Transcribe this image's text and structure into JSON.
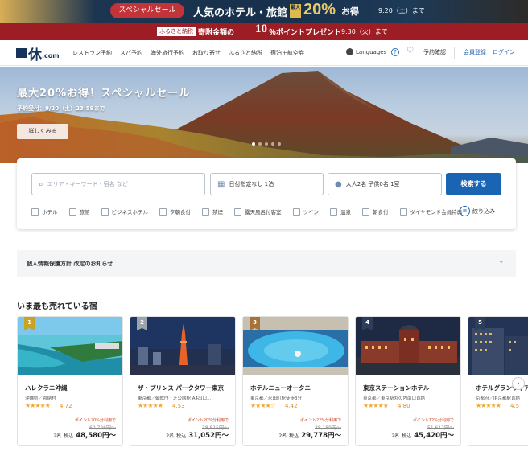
{
  "sale_banner": {
    "pill": "スペシャルセール",
    "title": "人気のホテル・旅館",
    "badge": "最大",
    "percent": "20%",
    "suffix": "お得",
    "date": "9.20（土）まで"
  },
  "furusato_banner": {
    "tag": "ふるさと納税",
    "text_before": "寄附金額の",
    "number": "10",
    "text_after": "％ポイントプレゼント",
    "date": "9.30（火）まで"
  },
  "nav": {
    "logo_kanji": "休",
    "logo_suffix": ".com",
    "links": [
      "レストラン予約",
      "スパ予約",
      "海外旅行予約",
      "お取り寄せ",
      "ふるさと納税",
      "宿泊＋航空券"
    ],
    "languages": "Languages",
    "help_icon": "?",
    "reservation": "予約確認",
    "member_register": "会員登録",
    "login": "ログイン"
  },
  "hero": {
    "title": "最大20%お得！スペシャルセール",
    "subtitle": "予約受付：9/20（土）23:59まで",
    "button": "詳しくみる",
    "slide_count": 5,
    "active_slide": 1
  },
  "search": {
    "area_placeholder": "エリア・キーワード・宿名 など",
    "date_value": "日付指定なし 1泊",
    "guest_value": "大人2名 子供0名 1室",
    "search_button": "検索する",
    "filters": [
      "ホテル",
      "旅館",
      "ビジネスホテル",
      "夕朝食付",
      "禁煙",
      "露天風呂付客室",
      "ツイン",
      "温泉",
      "朝食付",
      "ダイヤモンド会員特典"
    ],
    "more_filters": "絞り込み"
  },
  "notice": {
    "text": "個人情報保護方針 改定のお知らせ"
  },
  "best_sellers": {
    "title": "いま最も売れている宿",
    "hotels": [
      {
        "rank": "1",
        "name": "ハレクラニ沖縄",
        "location": "沖縄県／恩納村",
        "stars": "★★★★★",
        "score": "4.72",
        "points": "ポイント20%分利用で",
        "original_price": "60,726円〜",
        "people": "2名",
        "tax": "税込",
        "price": "48,580円〜",
        "rank_color": "#c9a227"
      },
      {
        "rank": "2",
        "name": "ザ・プリンス パークタワー東京",
        "location": "東京都／御成門・芝公園駅 A4出口…",
        "stars": "★★★★★",
        "score": "4.53",
        "points": "ポイント20%分利用で",
        "original_price": "38,815円〜",
        "people": "2名",
        "tax": "税込",
        "price": "31,052円〜",
        "rank_color": "#9ea4ab"
      },
      {
        "rank": "3",
        "name": "ホテルニューオータニ",
        "location": "東京都／永田町駅徒歩3分",
        "stars": "★★★★☆",
        "score": "4.42",
        "points": "ポイント22%分利用で",
        "original_price": "38,189円〜",
        "people": "2名",
        "tax": "税込",
        "price": "29,778円〜",
        "rank_color": "#a8713a"
      },
      {
        "rank": "4",
        "name": "東京ステーションホテル",
        "location": "東京都／東京駅丸の内南口直結",
        "stars": "★★★★★",
        "score": "4.80",
        "points": "ポイント12%分利用で",
        "original_price": "51,612円〜",
        "people": "2名",
        "tax": "税込",
        "price": "45,420円〜",
        "rank_color": "#2c3e5a"
      },
      {
        "rank": "5",
        "name": "ホテルグランヴィア京都",
        "location": "京都府／JR京都駅直結",
        "stars": "★★★★★",
        "score": "4.5",
        "points": "ポイント",
        "original_price": "",
        "people": "2名",
        "tax": "税込",
        "price": "",
        "rank_color": "#2c3e5a"
      }
    ]
  }
}
